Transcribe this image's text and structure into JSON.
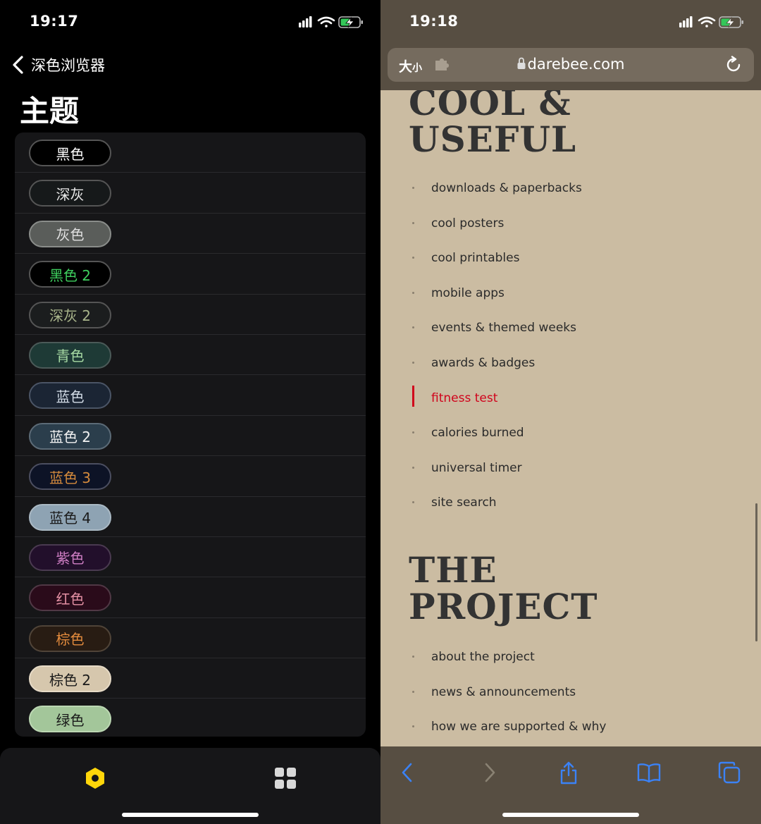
{
  "left": {
    "status": {
      "time": "19:17"
    },
    "nav": {
      "back_label": "深色浏览器"
    },
    "title": "主题",
    "themes": [
      {
        "label": "黑色",
        "bg": "#000000",
        "fg": "#ffffff",
        "border": "#555555"
      },
      {
        "label": "深灰",
        "bg": "#16191a",
        "fg": "#e8e8e8",
        "border": "#555555"
      },
      {
        "label": "灰色",
        "bg": "#5a5d5a",
        "fg": "#e0e0e0",
        "border": "#8a8d8a"
      },
      {
        "label": "黑色 2",
        "bg": "#000000",
        "fg": "#3ecf5e",
        "border": "#555555"
      },
      {
        "label": "深灰 2",
        "bg": "#1b1d1e",
        "fg": "#a9b58b",
        "border": "#555555"
      },
      {
        "label": "青色",
        "bg": "#1e3a36",
        "fg": "#a6d9a3",
        "border": "#4b5a58"
      },
      {
        "label": "蓝色",
        "bg": "#1b2534",
        "fg": "#d2dbe6",
        "border": "#4b5566"
      },
      {
        "label": "蓝色 2",
        "bg": "#2b3e4c",
        "fg": "#f2f2f2",
        "border": "#5c6b77"
      },
      {
        "label": "蓝色 3",
        "bg": "#0d1326",
        "fg": "#d48a3c",
        "border": "#4b4e60"
      },
      {
        "label": "蓝色 4",
        "bg": "#8ea3b3",
        "fg": "#1a1a1a",
        "border": "#aab9c4"
      },
      {
        "label": "紫色",
        "bg": "#220f2b",
        "fg": "#cf7ec4",
        "border": "#4a3a50"
      },
      {
        "label": "红色",
        "bg": "#2a0b1a",
        "fg": "#e591a4",
        "border": "#503845"
      },
      {
        "label": "棕色",
        "bg": "#281c13",
        "fg": "#e38b3d",
        "border": "#504438"
      },
      {
        "label": "棕色 2",
        "bg": "#d6c7ad",
        "fg": "#1a1a1a",
        "border": "#e6dac6"
      },
      {
        "label": "绿色",
        "bg": "#a3c69a",
        "fg": "#1a1a1a",
        "border": "#bcd8b3"
      }
    ],
    "tabbar": {
      "tabs": [
        {
          "icon": "hexagon-icon",
          "color": "#ffd60a"
        },
        {
          "icon": "grid-icon",
          "color": "#d8d8d8"
        }
      ]
    },
    "colors": {
      "background": "#000000",
      "list_bg": "#161618",
      "tabbar_bg": "#161618"
    }
  },
  "right": {
    "status": {
      "time": "19:18"
    },
    "address_bar": {
      "text_size_big": "大",
      "text_size_small": "小",
      "url": "darebee.com"
    },
    "sections": [
      {
        "heading_lines": [
          "COOL &",
          "USEFUL"
        ],
        "items": [
          "downloads & paperbacks",
          "cool posters",
          "cool printables",
          "mobile apps",
          "events & themed weeks",
          "awards & badges",
          "fitness test",
          "calories burned",
          "universal timer",
          "site search"
        ],
        "active_index": 6
      },
      {
        "heading_lines": [
          "THE",
          "PROJECT"
        ],
        "items": [
          "about the project",
          "news & announcements",
          "how we are supported & why"
        ],
        "active_index": -1
      }
    ],
    "toolbar": {
      "items": [
        {
          "icon": "back-chevron-icon",
          "enabled": true
        },
        {
          "icon": "forward-chevron-icon",
          "enabled": false
        },
        {
          "icon": "share-icon",
          "enabled": true
        },
        {
          "icon": "bookmarks-icon",
          "enabled": true
        },
        {
          "icon": "tabs-icon",
          "enabled": true
        }
      ]
    },
    "colors": {
      "page_bg": "#cbbca2",
      "chrome_bg": "#574e42",
      "address_bg": "#756b5e",
      "accent": "#3b82f6",
      "active_link": "#d0021b"
    }
  }
}
